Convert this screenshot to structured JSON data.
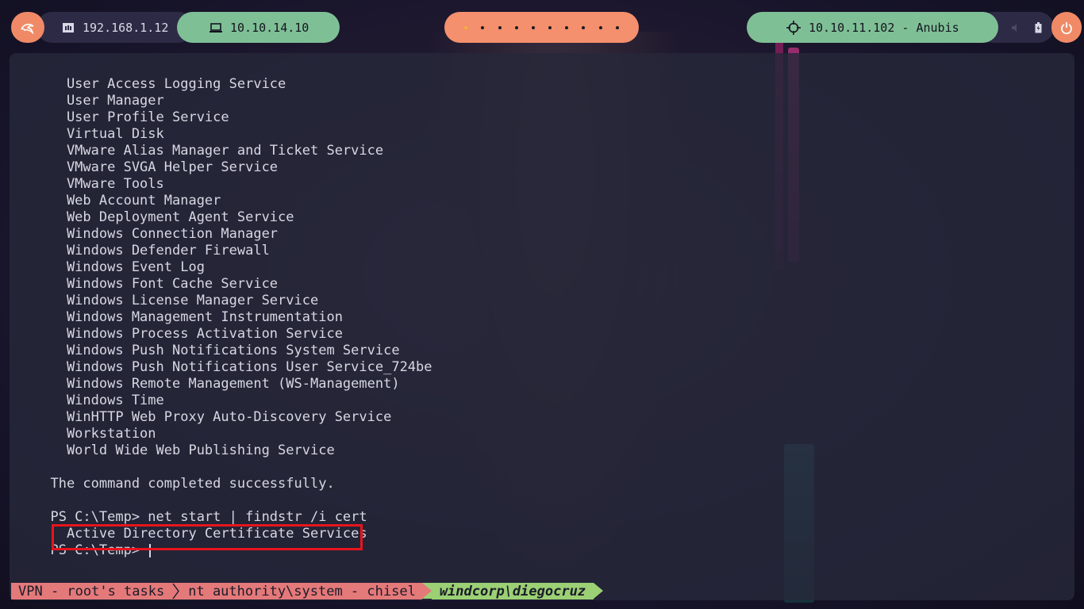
{
  "topbar": {
    "local_ip": "192.168.1.12",
    "vpn_ip": "10.10.14.10",
    "target": "10.10.11.102 - Anubis",
    "workspace_count": 10,
    "active_workspace": 1
  },
  "terminal": {
    "lines": [
      "    User Access Logging Service",
      "    User Manager",
      "    User Profile Service",
      "    Virtual Disk",
      "    VMware Alias Manager and Ticket Service",
      "    VMware SVGA Helper Service",
      "    VMware Tools",
      "    Web Account Manager",
      "    Web Deployment Agent Service",
      "    Windows Connection Manager",
      "    Windows Defender Firewall",
      "    Windows Event Log",
      "    Windows Font Cache Service",
      "    Windows License Manager Service",
      "    Windows Management Instrumentation",
      "    Windows Process Activation Service",
      "    Windows Push Notifications System Service",
      "    Windows Push Notifications User Service_724be",
      "    Windows Remote Management (WS-Management)",
      "    Windows Time",
      "    WinHTTP Web Proxy Auto-Discovery Service",
      "    Workstation",
      "    World Wide Web Publishing Service",
      "",
      "  The command completed successfully.",
      "",
      "  PS C:\\Temp> net start | findstr /i cert",
      "    Active Directory Certificate Services",
      "  PS C:\\Temp> "
    ]
  },
  "statusbar": {
    "vpn": "VPN - root's tasks",
    "nt": "nt authority\\system - chisel",
    "active": "windcorp\\diegocruz"
  },
  "colors": {
    "accent_orange": "#f08a66",
    "accent_green": "#7fbf96",
    "highlight_red": "#e8141c",
    "tmux_active": "#9bd074",
    "tmux_inactive": "#e4797a"
  }
}
